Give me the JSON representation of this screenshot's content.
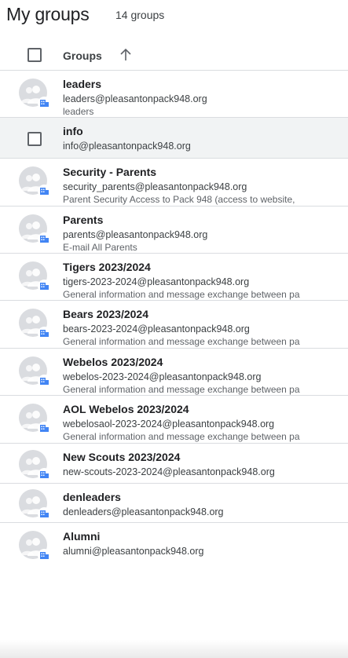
{
  "header": {
    "title": "My groups",
    "count": "14 groups"
  },
  "columns": {
    "groups_label": "Groups"
  },
  "icons": {
    "sort": "arrow-up-icon",
    "avatar": "group-avatar-icon",
    "badge": "directory-badge-icon"
  },
  "colors": {
    "badge": "#4285f4",
    "avatar_bg": "#dadce0"
  },
  "groups": [
    {
      "name": "leaders",
      "email": "leaders@pleasantonpack948.org",
      "description": "leaders"
    },
    {
      "name": "info",
      "email": "info@pleasantonpack948.org",
      "description": ""
    },
    {
      "name": "Security - Parents",
      "email": "security_parents@pleasantonpack948.org",
      "description": "Parent Security Access to Pack 948 (access to website,"
    },
    {
      "name": "Parents",
      "email": "parents@pleasantonpack948.org",
      "description": "E-mail All Parents"
    },
    {
      "name": "Tigers 2023/2024",
      "email": "tigers-2023-2024@pleasantonpack948.org",
      "description": "General information and message exchange between pa"
    },
    {
      "name": "Bears 2023/2024",
      "email": "bears-2023-2024@pleasantonpack948.org",
      "description": "General information and message exchange between pa"
    },
    {
      "name": "Webelos 2023/2024",
      "email": "webelos-2023-2024@pleasantonpack948.org",
      "description": "General information and message exchange between pa"
    },
    {
      "name": "AOL Webelos 2023/2024",
      "email": "webelosaol-2023-2024@pleasantonpack948.org",
      "description": "General information and message exchange between pa"
    },
    {
      "name": "New Scouts 2023/2024",
      "email": "new-scouts-2023-2024@pleasantonpack948.org",
      "description": ""
    },
    {
      "name": "denleaders",
      "email": "denleaders@pleasantonpack948.org",
      "description": ""
    },
    {
      "name": "Alumni",
      "email": "alumni@pleasantonpack948.org",
      "description": ""
    }
  ]
}
